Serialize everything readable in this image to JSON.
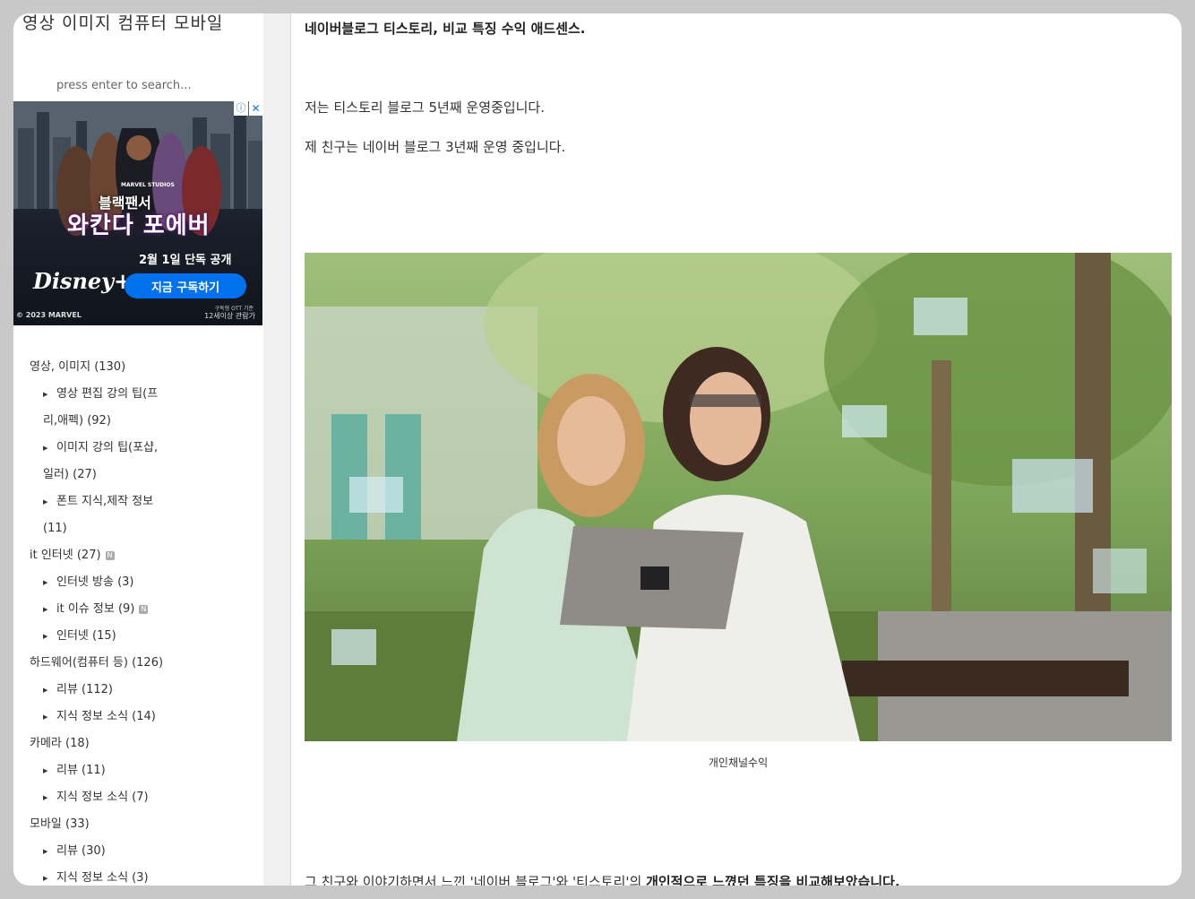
{
  "sidebar": {
    "site_title": "영상 이미지 컴퓨터 모바일",
    "search_placeholder": "press enter to search...",
    "categories": [
      {
        "label": "영상, 이미지 (130)",
        "level": 0
      },
      {
        "label": "영상 편집 강의 팁(프",
        "level": 1
      },
      {
        "label": "리,애펙) (92)",
        "level": 2
      },
      {
        "label": "이미지 강의 팁(포샵,",
        "level": 1
      },
      {
        "label": "일러) (27)",
        "level": 2
      },
      {
        "label": "폰트 지식,제작 정보",
        "level": 1
      },
      {
        "label": "(11)",
        "level": 2
      },
      {
        "label": "it 인터넷 (27)",
        "level": 0,
        "new": true
      },
      {
        "label": "인터넷 방송 (3)",
        "level": 1
      },
      {
        "label": "it 이슈 정보 (9)",
        "level": 1,
        "new": true
      },
      {
        "label": "인터넷 (15)",
        "level": 1
      },
      {
        "label": "하드웨어(컴퓨터 등) (126)",
        "level": 0
      },
      {
        "label": "리뷰 (112)",
        "level": 1
      },
      {
        "label": "지식 정보 소식 (14)",
        "level": 1
      },
      {
        "label": "카메라 (18)",
        "level": 0
      },
      {
        "label": "리뷰 (11)",
        "level": 1
      },
      {
        "label": "지식 정보 소식 (7)",
        "level": 1
      },
      {
        "label": "모바일 (33)",
        "level": 0
      },
      {
        "label": "리뷰 (30)",
        "level": 1
      },
      {
        "label": "지식 정보 소식 (3)",
        "level": 1
      }
    ],
    "new_badge": "N"
  },
  "ad": {
    "brand_small": "MARVEL STUDIOS",
    "title": "블랙팬서",
    "subtitle": "와칸다 포에버",
    "release": "2월 1일 단독 공개",
    "streaming_logo": "Disney+",
    "cta": "지금 구독하기",
    "copyright": "© 2023 MARVEL",
    "note": "구독형 OTT 기준",
    "rating": "12세이상 관람가",
    "info_icon": "ⓘ",
    "close_icon": "✕"
  },
  "article": {
    "heading": "네이버블로그 티스토리, 비교 특징 수익 애드센스.",
    "para1": "저는 티스토리 블로그 5년째 운영중입니다.",
    "para2": "제 친구는 네이버 블로그 3년째 운영 중입니다.",
    "image_caption": "개인채널수익",
    "last_para_normal": "그 친구와 이야기하면서 느낀 '네이버 블로그'와 '티스토리'의 ",
    "last_para_bold": "개인적으로 느꼈던 특징을 비교해보았습니다."
  }
}
